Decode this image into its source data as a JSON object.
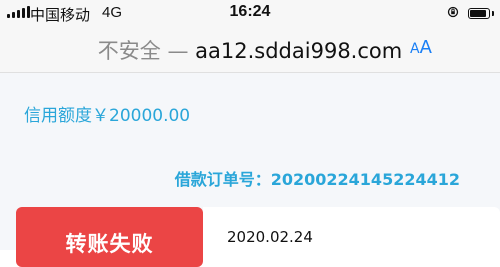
{
  "status_bar": {
    "carrier": "中国移动",
    "network": "4G",
    "time": "16:24"
  },
  "address_bar": {
    "insecure_label": "不安全",
    "separator": "—",
    "url": "aa12.sddai998.com",
    "text_size_button": "AA"
  },
  "page": {
    "credit_line": "信用额度￥20000.00",
    "order_label": "借款订单号：",
    "order_number": "20200224145224412",
    "status_button": "转账失败",
    "date": "2020.02.24"
  },
  "colors": {
    "accent_blue": "#2aa6d9",
    "status_red": "#eb4545",
    "safari_blue": "#1a7ff5"
  }
}
